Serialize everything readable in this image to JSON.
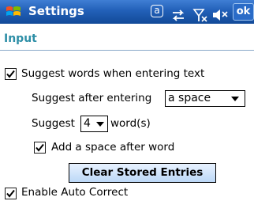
{
  "titlebar": {
    "title": "Settings",
    "input_mode": "a",
    "ok_label": "ok",
    "icons": [
      "windows-logo-icon",
      "sync-icon",
      "signal-icon",
      "volume-icon"
    ]
  },
  "section": {
    "title": "Input"
  },
  "options": {
    "suggest_words": {
      "label": "Suggest words when entering text",
      "checked": true
    },
    "suggest_after": {
      "label": "Suggest after entering",
      "value": "a space"
    },
    "suggest_count": {
      "prefix": "Suggest",
      "value": "4",
      "suffix": "word(s)"
    },
    "add_space": {
      "label": "Add a space after word",
      "checked": true
    },
    "clear_button": "Clear Stored Entries",
    "auto_correct": {
      "label": "Enable Auto Correct",
      "checked": true
    }
  },
  "colors": {
    "titlebar": "#2260b8",
    "section_header": "#2e8fa7",
    "button": "#bcd8f7"
  }
}
